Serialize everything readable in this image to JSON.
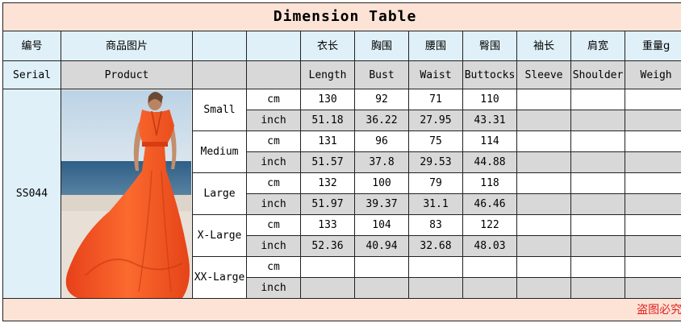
{
  "title": "Dimension Table",
  "header_cn": {
    "serial": "编号",
    "product": "商品图片",
    "length": "衣长",
    "bust": "胸围",
    "waist": "腰围",
    "buttocks": "臀围",
    "sleeve": "袖长",
    "shoulder": "肩宽",
    "weight": "重量g"
  },
  "header_en": {
    "serial": "Serial",
    "product": "Product",
    "length": "Length",
    "bust": "Bust",
    "waist": "Waist",
    "buttocks": "Buttocks",
    "sleeve": "Sleeve",
    "shoulder": "Shoulder",
    "weight": "Weigh"
  },
  "serial": "SS044",
  "units": {
    "cm": "cm",
    "inch": "inch"
  },
  "sizes": [
    {
      "name": "Small",
      "cm": [
        "130",
        "92",
        "71",
        "110"
      ],
      "inch": [
        "51.18",
        "36.22",
        "27.95",
        "43.31"
      ]
    },
    {
      "name": "Medium",
      "cm": [
        "131",
        "96",
        "75",
        "114"
      ],
      "inch": [
        "51.57",
        "37.8",
        "29.53",
        "44.88"
      ]
    },
    {
      "name": "Large",
      "cm": [
        "132",
        "100",
        "79",
        "118"
      ],
      "inch": [
        "51.97",
        "39.37",
        "31.1",
        "46.46"
      ]
    },
    {
      "name": "X-Large",
      "cm": [
        "133",
        "104",
        "83",
        "122"
      ],
      "inch": [
        "52.36",
        "40.94",
        "32.68",
        "48.03"
      ]
    },
    {
      "name": "XX-Large",
      "cm": [
        "",
        "",
        "",
        ""
      ],
      "inch": [
        "",
        "",
        "",
        ""
      ]
    }
  ],
  "footer": "盗图必究",
  "colors": {
    "title_bg": "#fde3d6",
    "header_blue": "#dff0f8",
    "header_grey": "#d8d8d8",
    "footer_text": "#e02020",
    "dress": "#f4511e"
  }
}
